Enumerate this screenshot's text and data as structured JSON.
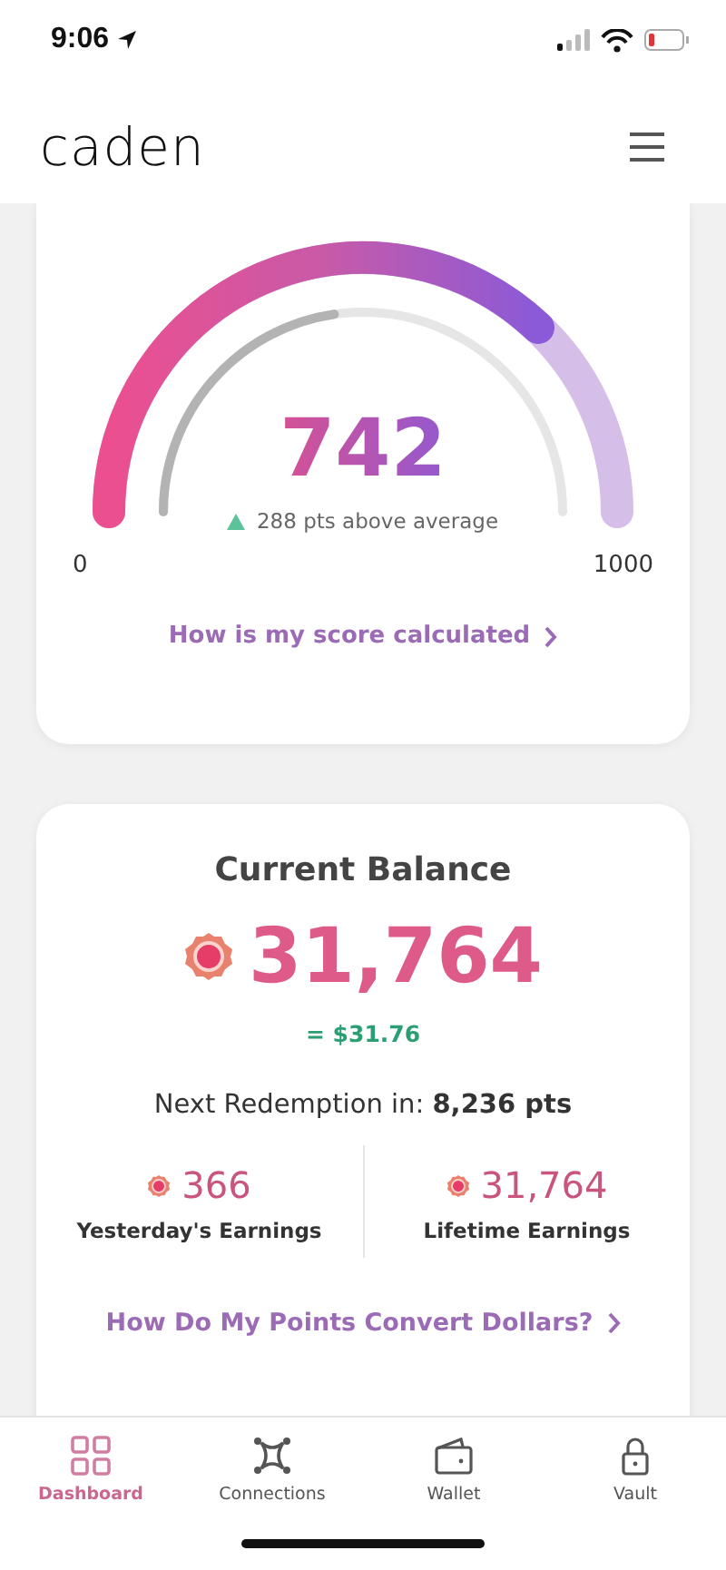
{
  "status_bar": {
    "time": "9:06"
  },
  "header": {
    "logo": "caden"
  },
  "score_card": {
    "score": "742",
    "delta": "288 pts above average",
    "min_label": "0",
    "max_label": "1000",
    "link": "How is my score calculated"
  },
  "balance_card": {
    "title": "Current Balance",
    "points": "31,764",
    "dollars": "= $31.76",
    "next_redemption": "Next Redemption in: **8,236 pts**",
    "stats": [
      {
        "value": "366",
        "label": "Yesterday's Earnings"
      },
      {
        "value": "31,764",
        "label": "Lifetime Earnings"
      }
    ],
    "link": "How Do My Points Convert Dollars?"
  },
  "tabs": [
    {
      "label": "Dashboard",
      "selected": true
    },
    {
      "label": "Connections",
      "selected": false
    },
    {
      "label": "Wallet",
      "selected": false
    },
    {
      "label": "Vault",
      "selected": false
    }
  ]
}
